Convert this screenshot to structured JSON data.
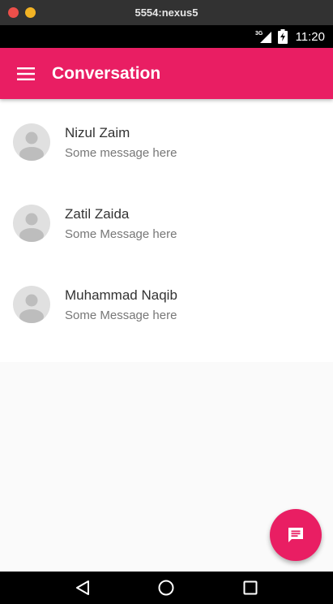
{
  "window": {
    "title": "5554:nexus5"
  },
  "status_bar": {
    "network": "3G",
    "time": "11:20"
  },
  "app_bar": {
    "title": "Conversation",
    "menu_icon": "menu-icon"
  },
  "conversations": [
    {
      "name": "Nizul Zaim",
      "message": "Some message here"
    },
    {
      "name": "Zatil Zaida",
      "message": "Some Message here"
    },
    {
      "name": "Muhammad Naqib",
      "message": "Some Message here"
    }
  ],
  "fab": {
    "icon": "message-icon"
  },
  "nav_bar": {
    "back_icon": "back-icon",
    "home_icon": "home-icon",
    "recents_icon": "recents-icon"
  },
  "colors": {
    "primary": "#e91e63",
    "background": "#fafafa"
  }
}
